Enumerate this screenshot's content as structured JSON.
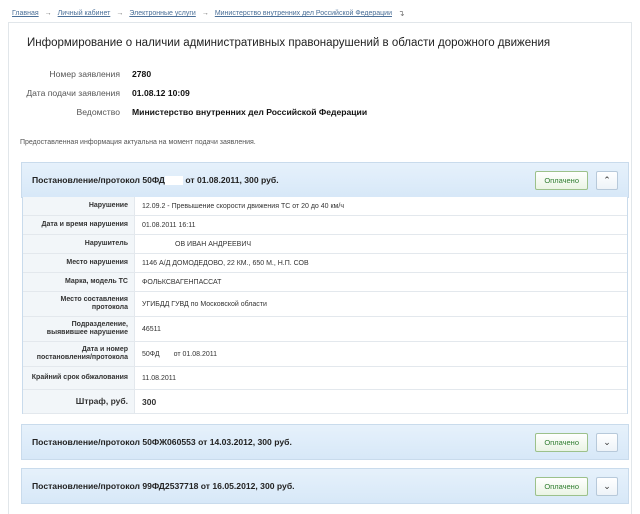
{
  "breadcrumb": [
    "Главная",
    "Личный кабинет",
    "Электронные услуги",
    "Министерство внутренних дел Российской Федерации"
  ],
  "page_title": "Информирование о наличии административных правонарушений в области дорожного движения",
  "meta": [
    {
      "label": "Номер заявления",
      "value": "2780"
    },
    {
      "label": "Дата подачи заявления",
      "value": "01.08.12 10:09"
    },
    {
      "label": "Ведомство",
      "value": "Министерство внутренних дел Российской Федерации"
    }
  ],
  "info_note": "Предоставленная информация актуальна на момент подачи заявления.",
  "paid_label": "Оплачено",
  "panels": [
    {
      "title_a": "Постановление/протокол 50ФД",
      "title_b": " от 01.08.2011, 300 руб."
    },
    {
      "title": "Постановление/протокол 50ФЖ060553 от 14.03.2012, 300 руб."
    },
    {
      "title": "Постановление/протокол 99ФД2537718 от 16.05.2012, 300 руб."
    }
  ],
  "details": [
    {
      "label": "Нарушение",
      "value": "12.09.2 - Превышение скорости движения ТС от 20 до 40 км/ч"
    },
    {
      "label": "Дата и время нарушения",
      "value": "01.08.2011 16:11"
    },
    {
      "label": "Нарушитель",
      "value": "ОВ ИВАН АНДРЕЕВИЧ"
    },
    {
      "label": "Место нарушения",
      "value": "1146 А/Д ДОМОДЕДОВО, 22 КМ., 650 М., Н.П. СОВ"
    },
    {
      "label": "Марка, модель ТС",
      "value": "ФОЛЬКСВАГЕНПАССАТ"
    },
    {
      "label": "Место составления протокола",
      "value": "УГИБДД ГУВД по Московской области"
    },
    {
      "label": "Подразделение, выявившее нарушение",
      "value": "46511"
    },
    {
      "label": "Дата и номер постановления/протокола",
      "value_a": "50ФД",
      "value_b": " от 01.08.2011"
    },
    {
      "label": "Крайний срок обжалования",
      "value": "11.08.2011"
    },
    {
      "label": "Штраф, руб.",
      "value": "300"
    }
  ],
  "icons": {
    "separator": "arrow-right-icon",
    "collapse": "chevron-up-icon",
    "expand": "chevron-down-icon"
  },
  "colors": {
    "link": "#4a6f98",
    "panel_bg": "#dcebf9",
    "paid_text": "#2f7d2f"
  }
}
